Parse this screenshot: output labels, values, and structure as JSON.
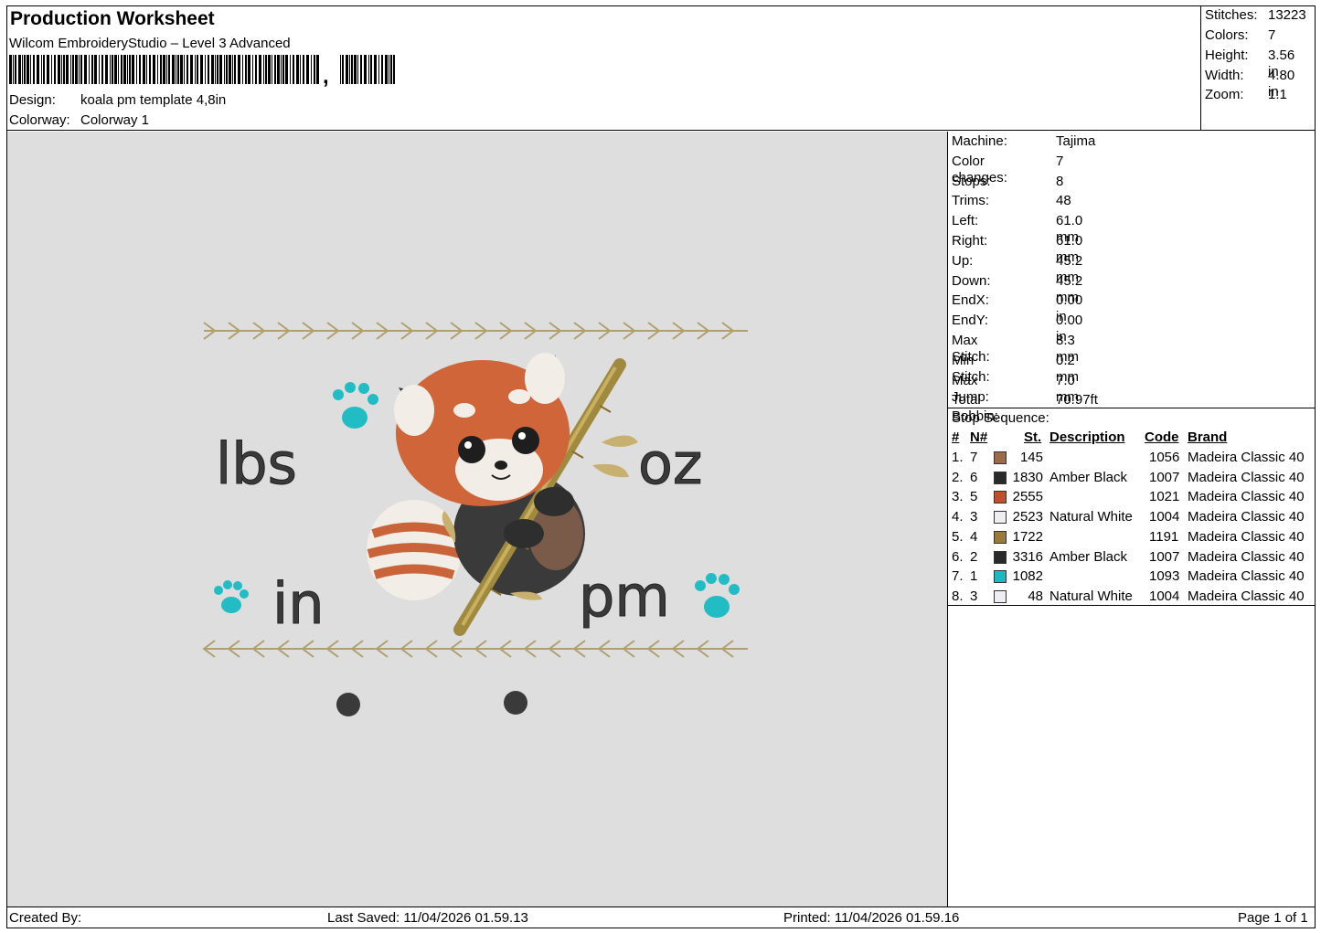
{
  "header": {
    "title": "Production Worksheet",
    "software": "Wilcom EmbroideryStudio – Level 3 Advanced",
    "design_label": "Design:",
    "design_value": "koala pm template 4,8in",
    "colorway_label": "Colorway:",
    "colorway_value": "Colorway 1"
  },
  "stats": [
    {
      "label": "Stitches:",
      "value": "13223"
    },
    {
      "label": "Colors:",
      "value": "7"
    },
    {
      "label": "Height:",
      "value": "3.56 in"
    },
    {
      "label": "Width:",
      "value": "4.80 in"
    },
    {
      "label": "Zoom:",
      "value": "1:1"
    }
  ],
  "machine_info": [
    {
      "label": "Machine:",
      "value": "Tajima"
    },
    {
      "label": "Color changes:",
      "value": "7"
    },
    {
      "label": "Stops:",
      "value": "8"
    },
    {
      "label": "Trims:",
      "value": "48"
    },
    {
      "label": "Left:",
      "value": "61.0 mm"
    },
    {
      "label": "Right:",
      "value": "61.0 mm"
    },
    {
      "label": "Up:",
      "value": "45.2 mm"
    },
    {
      "label": "Down:",
      "value": "45.2 mm"
    },
    {
      "label": "EndX:",
      "value": "0.00 in"
    },
    {
      "label": "EndY:",
      "value": "0.00 in"
    },
    {
      "label": "Max Stitch:",
      "value": "8.3 mm"
    },
    {
      "label": "Min Stitch:",
      "value": "0.2 mm"
    },
    {
      "label": "Max Jump:",
      "value": "7.0 mm"
    },
    {
      "label": "Total Bobbin:",
      "value": "70.97ft"
    }
  ],
  "stop_sequence": {
    "title": "Stop Sequence:",
    "columns": {
      "num": "#",
      "n": "N#",
      "st": "St.",
      "desc": "Description",
      "code": "Code",
      "brand": "Brand"
    },
    "rows": [
      {
        "num": "1.",
        "n": "7",
        "color": "#9a6a4a",
        "st": "145",
        "desc": "",
        "code": "1056",
        "brand": "Madeira Classic 40"
      },
      {
        "num": "2.",
        "n": "6",
        "color": "#2a2a2a",
        "st": "1830",
        "desc": "Amber Black",
        "code": "1007",
        "brand": "Madeira Classic 40"
      },
      {
        "num": "3.",
        "n": "5",
        "color": "#c0502a",
        "st": "2555",
        "desc": "",
        "code": "1021",
        "brand": "Madeira Classic 40"
      },
      {
        "num": "4.",
        "n": "3",
        "color": "#eeeef2",
        "st": "2523",
        "desc": "Natural White",
        "code": "1004",
        "brand": "Madeira Classic 40"
      },
      {
        "num": "5.",
        "n": "4",
        "color": "#9a7a3a",
        "st": "1722",
        "desc": "",
        "code": "1191",
        "brand": "Madeira Classic 40"
      },
      {
        "num": "6.",
        "n": "2",
        "color": "#2a2a2a",
        "st": "3316",
        "desc": "Amber Black",
        "code": "1007",
        "brand": "Madeira Classic 40"
      },
      {
        "num": "7.",
        "n": "1",
        "color": "#20b8c0",
        "st": "1082",
        "desc": "",
        "code": "1093",
        "brand": "Madeira Classic 40"
      },
      {
        "num": "8.",
        "n": "3",
        "color": "#eeeef2",
        "st": "48",
        "desc": "Natural White",
        "code": "1004",
        "brand": "Madeira Classic 40"
      }
    ]
  },
  "design_text": {
    "lbs": "lbs",
    "oz": "oz",
    "in": "in",
    "pm": "pm"
  },
  "footer": {
    "created_by": "Created By:",
    "last_saved": "Last Saved: 11/04/2026 01.59.13",
    "printed": "Printed: 11/04/2026 01.59.16",
    "page": "Page 1 of 1"
  }
}
